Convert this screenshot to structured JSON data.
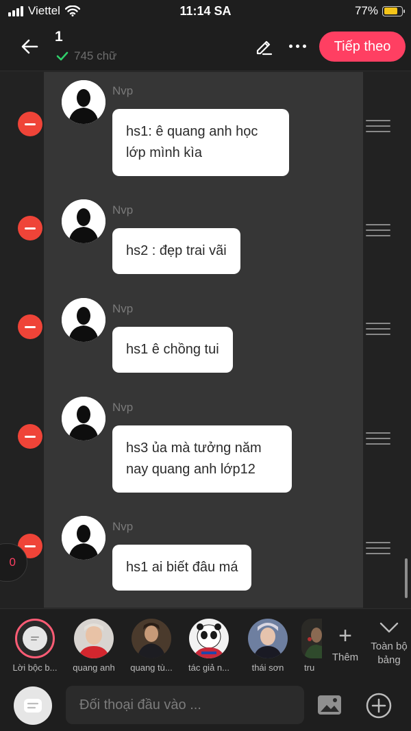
{
  "status_bar": {
    "carrier": "Viettel",
    "time": "11:14 SA",
    "battery": "77%",
    "battery_level": 0.77
  },
  "header": {
    "title": "1",
    "word_count": "745 chữ",
    "next_label": "Tiếp theo"
  },
  "messages": [
    {
      "name": "Nvp",
      "text": "hs1: ê quang anh học lớp mình kìa"
    },
    {
      "name": "Nvp",
      "text": "hs2 : đẹp trai vãi"
    },
    {
      "name": "Nvp",
      "text": "hs1 ê chồng tui"
    },
    {
      "name": "Nvp",
      "text": "hs3 ủa mà tưởng năm nay quang anh lớp12"
    },
    {
      "name": "Nvp",
      "text": "hs1 ai biết đâu má"
    }
  ],
  "counter": "0",
  "characters": [
    {
      "label": "Lời bộc b..."
    },
    {
      "label": "quang anh"
    },
    {
      "label": "quang tù..."
    },
    {
      "label": "tác giả n..."
    },
    {
      "label": "thái sơn"
    },
    {
      "label": "tru"
    }
  ],
  "add_character_label": "Thêm",
  "full_board_label": "Toàn bộ bảng",
  "input": {
    "placeholder": "Đối thoại đầu vào ..."
  },
  "colors": {
    "accent": "#ff3f62",
    "delete": "#ef4438",
    "background": "#222222",
    "panel": "#363636"
  }
}
